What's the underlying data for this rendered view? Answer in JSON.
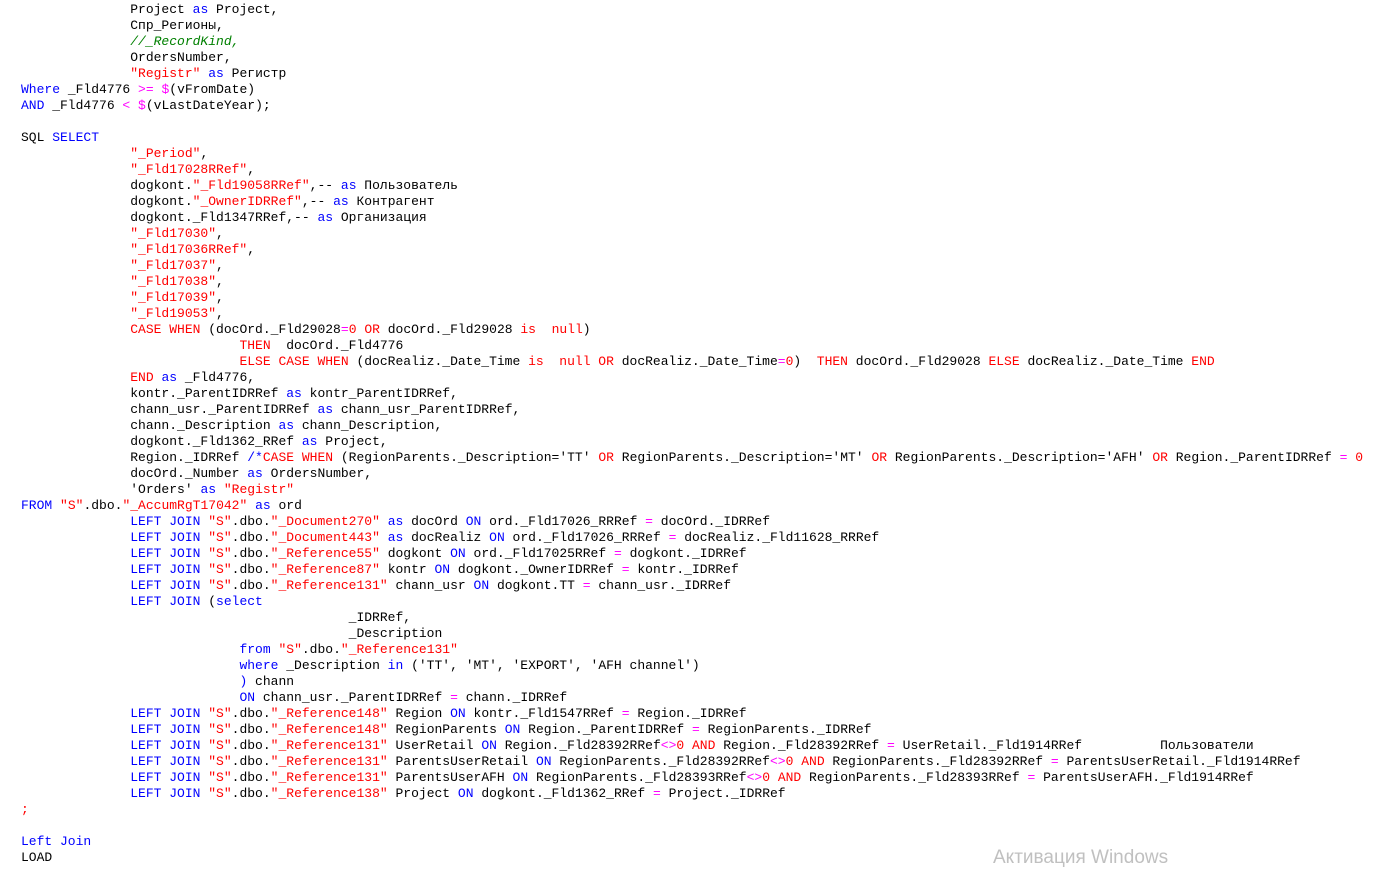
{
  "colors": {
    "keyword": "#0000ff",
    "string": "#ff0000",
    "comment": "#008000",
    "operator": "#ff00ff",
    "text": "#000000",
    "watermark": "#c0c0c0"
  },
  "watermark": "Активация Windows",
  "code_lines": [
    [
      [
        "t",
        "              Project "
      ],
      [
        "k",
        "as"
      ],
      [
        "t",
        " Project,"
      ]
    ],
    [
      [
        "t",
        "              Спр_Регионы,"
      ]
    ],
    [
      [
        "c",
        "              //_RecordKind,"
      ]
    ],
    [
      [
        "t",
        "              OrdersNumber,"
      ]
    ],
    [
      [
        "t",
        "              "
      ],
      [
        "s",
        "\"Registr\""
      ],
      [
        "t",
        " "
      ],
      [
        "k",
        "as"
      ],
      [
        "t",
        " Регистр"
      ]
    ],
    [
      [
        "k",
        "Where"
      ],
      [
        "t",
        " _Fld4776 "
      ],
      [
        "o",
        ">="
      ],
      [
        "t",
        " "
      ],
      [
        "o",
        "$"
      ],
      [
        "t",
        "(vFromDate)"
      ]
    ],
    [
      [
        "k",
        "AND"
      ],
      [
        "t",
        " _Fld4776 "
      ],
      [
        "o",
        "<"
      ],
      [
        "t",
        " "
      ],
      [
        "o",
        "$"
      ],
      [
        "t",
        "(vLastDateYear);"
      ]
    ],
    [
      [
        "t",
        ""
      ]
    ],
    [
      [
        "t",
        "SQL "
      ],
      [
        "k",
        "SELECT"
      ]
    ],
    [
      [
        "t",
        "              "
      ],
      [
        "s",
        "\"_Period\""
      ],
      [
        "t",
        ","
      ]
    ],
    [
      [
        "t",
        "              "
      ],
      [
        "s",
        "\"_Fld17028RRef\""
      ],
      [
        "t",
        ","
      ]
    ],
    [
      [
        "t",
        "              dogkont."
      ],
      [
        "s",
        "\"_Fld19058RRef\""
      ],
      [
        "t",
        ",-- "
      ],
      [
        "k",
        "as"
      ],
      [
        "t",
        " Пользователь"
      ]
    ],
    [
      [
        "t",
        "              dogkont."
      ],
      [
        "s",
        "\"_OwnerIDRRef\""
      ],
      [
        "t",
        ",-- "
      ],
      [
        "k",
        "as"
      ],
      [
        "t",
        " Контрагент"
      ]
    ],
    [
      [
        "t",
        "              dogkont._Fld1347RRef,-- "
      ],
      [
        "k",
        "as"
      ],
      [
        "t",
        " Организация"
      ]
    ],
    [
      [
        "t",
        "              "
      ],
      [
        "s",
        "\"_Fld17030\""
      ],
      [
        "t",
        ","
      ]
    ],
    [
      [
        "t",
        "              "
      ],
      [
        "s",
        "\"_Fld17036RRef\""
      ],
      [
        "t",
        ","
      ]
    ],
    [
      [
        "t",
        "              "
      ],
      [
        "s",
        "\"_Fld17037\""
      ],
      [
        "t",
        ","
      ]
    ],
    [
      [
        "t",
        "              "
      ],
      [
        "s",
        "\"_Fld17038\""
      ],
      [
        "t",
        ","
      ]
    ],
    [
      [
        "t",
        "              "
      ],
      [
        "s",
        "\"_Fld17039\""
      ],
      [
        "t",
        ","
      ]
    ],
    [
      [
        "t",
        "              "
      ],
      [
        "s",
        "\"_Fld19053\""
      ],
      [
        "t",
        ","
      ]
    ],
    [
      [
        "t",
        "              "
      ],
      [
        "s",
        "CASE WHEN"
      ],
      [
        "t",
        " (docOrd._Fld29028"
      ],
      [
        "o",
        "="
      ],
      [
        "s",
        "0"
      ],
      [
        "t",
        " "
      ],
      [
        "s",
        "OR"
      ],
      [
        "t",
        " docOrd._Fld29028 "
      ],
      [
        "s",
        "is  null"
      ],
      [
        "t",
        ")"
      ]
    ],
    [
      [
        "t",
        "                            "
      ],
      [
        "s",
        "THEN"
      ],
      [
        "t",
        "  docOrd._Fld4776"
      ]
    ],
    [
      [
        "t",
        "                            "
      ],
      [
        "s",
        "ELSE CASE WHEN"
      ],
      [
        "t",
        " (docRealiz._Date_Time "
      ],
      [
        "s",
        "is  null OR"
      ],
      [
        "t",
        " docRealiz._Date_Time"
      ],
      [
        "o",
        "="
      ],
      [
        "s",
        "0"
      ],
      [
        "t",
        ")  "
      ],
      [
        "s",
        "THEN"
      ],
      [
        "t",
        " docOrd._Fld29028 "
      ],
      [
        "s",
        "ELSE"
      ],
      [
        "t",
        " docRealiz._Date_Time "
      ],
      [
        "s",
        "END"
      ]
    ],
    [
      [
        "t",
        "              "
      ],
      [
        "s",
        "END"
      ],
      [
        "t",
        " "
      ],
      [
        "k",
        "as"
      ],
      [
        "t",
        " _Fld4776,"
      ]
    ],
    [
      [
        "t",
        "              kontr._ParentIDRRef "
      ],
      [
        "k",
        "as"
      ],
      [
        "t",
        " kontr_ParentIDRRef,"
      ]
    ],
    [
      [
        "t",
        "              chann_usr._ParentIDRRef "
      ],
      [
        "k",
        "as"
      ],
      [
        "t",
        " chann_usr_ParentIDRRef,"
      ]
    ],
    [
      [
        "t",
        "              chann._Description "
      ],
      [
        "k",
        "as"
      ],
      [
        "t",
        " chann_Description,"
      ]
    ],
    [
      [
        "t",
        "              dogkont._Fld1362_RRef "
      ],
      [
        "k",
        "as"
      ],
      [
        "t",
        " Project,"
      ]
    ],
    [
      [
        "t",
        "              Region._IDRRef "
      ],
      [
        "k",
        "/*"
      ],
      [
        "s",
        "CASE WHEN"
      ],
      [
        "t",
        " (RegionParents._Description="
      ],
      [
        "t",
        "'TT'"
      ],
      [
        "t",
        " "
      ],
      [
        "s",
        "OR"
      ],
      [
        "t",
        " RegionParents._Description="
      ],
      [
        "t",
        "'MT'"
      ],
      [
        "t",
        " "
      ],
      [
        "s",
        "OR"
      ],
      [
        "t",
        " RegionParents._Description="
      ],
      [
        "t",
        "'AFH'"
      ],
      [
        "t",
        " "
      ],
      [
        "s",
        "OR"
      ],
      [
        "t",
        " Region._ParentIDRRef "
      ],
      [
        "o",
        "="
      ],
      [
        "t",
        " "
      ],
      [
        "s",
        "0"
      ]
    ],
    [
      [
        "t",
        "              docOrd._Number "
      ],
      [
        "k",
        "as"
      ],
      [
        "t",
        " OrdersNumber,"
      ]
    ],
    [
      [
        "t",
        "              'Orders' "
      ],
      [
        "k",
        "as"
      ],
      [
        "t",
        " "
      ],
      [
        "s",
        "\"Registr\""
      ]
    ],
    [
      [
        "k",
        "FROM"
      ],
      [
        "t",
        " "
      ],
      [
        "s",
        "\"S\""
      ],
      [
        "t",
        ".dbo."
      ],
      [
        "s",
        "\"_AccumRgT17042\""
      ],
      [
        "t",
        " "
      ],
      [
        "k",
        "as"
      ],
      [
        "t",
        " ord"
      ]
    ],
    [
      [
        "t",
        "              "
      ],
      [
        "k",
        "LEFT JOIN"
      ],
      [
        "t",
        " "
      ],
      [
        "s",
        "\"S\""
      ],
      [
        "t",
        ".dbo."
      ],
      [
        "s",
        "\"_Document270\""
      ],
      [
        "t",
        " "
      ],
      [
        "k",
        "as"
      ],
      [
        "t",
        " docOrd "
      ],
      [
        "k",
        "ON"
      ],
      [
        "t",
        " ord._Fld17026_RRRef "
      ],
      [
        "o",
        "="
      ],
      [
        "t",
        " docOrd._IDRRef"
      ]
    ],
    [
      [
        "t",
        "              "
      ],
      [
        "k",
        "LEFT JOIN"
      ],
      [
        "t",
        " "
      ],
      [
        "s",
        "\"S\""
      ],
      [
        "t",
        ".dbo."
      ],
      [
        "s",
        "\"_Document443\""
      ],
      [
        "t",
        " "
      ],
      [
        "k",
        "as"
      ],
      [
        "t",
        " docRealiz "
      ],
      [
        "k",
        "ON"
      ],
      [
        "t",
        " ord._Fld17026_RRRef "
      ],
      [
        "o",
        "="
      ],
      [
        "t",
        " docRealiz._Fld11628_RRRef"
      ]
    ],
    [
      [
        "t",
        "              "
      ],
      [
        "k",
        "LEFT JOIN"
      ],
      [
        "t",
        " "
      ],
      [
        "s",
        "\"S\""
      ],
      [
        "t",
        ".dbo."
      ],
      [
        "s",
        "\"_Reference55\""
      ],
      [
        "t",
        " dogkont "
      ],
      [
        "k",
        "ON"
      ],
      [
        "t",
        " ord._Fld17025RRef "
      ],
      [
        "o",
        "="
      ],
      [
        "t",
        " dogkont._IDRRef"
      ]
    ],
    [
      [
        "t",
        "              "
      ],
      [
        "k",
        "LEFT JOIN"
      ],
      [
        "t",
        " "
      ],
      [
        "s",
        "\"S\""
      ],
      [
        "t",
        ".dbo."
      ],
      [
        "s",
        "\"_Reference87\""
      ],
      [
        "t",
        " kontr "
      ],
      [
        "k",
        "ON"
      ],
      [
        "t",
        " dogkont._OwnerIDRRef "
      ],
      [
        "o",
        "="
      ],
      [
        "t",
        " kontr._IDRRef"
      ]
    ],
    [
      [
        "t",
        "              "
      ],
      [
        "k",
        "LEFT JOIN"
      ],
      [
        "t",
        " "
      ],
      [
        "s",
        "\"S\""
      ],
      [
        "t",
        ".dbo."
      ],
      [
        "s",
        "\"_Reference131\""
      ],
      [
        "t",
        " chann_usr "
      ],
      [
        "k",
        "ON"
      ],
      [
        "t",
        " dogkont.TT "
      ],
      [
        "o",
        "="
      ],
      [
        "t",
        " chann_usr._IDRRef"
      ]
    ],
    [
      [
        "t",
        "              "
      ],
      [
        "k",
        "LEFT JOIN"
      ],
      [
        "t",
        " ("
      ],
      [
        "k",
        "select"
      ]
    ],
    [
      [
        "t",
        "                                          _IDRRef,"
      ]
    ],
    [
      [
        "t",
        "                                          _Description"
      ]
    ],
    [
      [
        "t",
        "                            "
      ],
      [
        "k",
        "from"
      ],
      [
        "t",
        " "
      ],
      [
        "s",
        "\"S\""
      ],
      [
        "t",
        ".dbo."
      ],
      [
        "s",
        "\"_Reference131\""
      ]
    ],
    [
      [
        "t",
        "                            "
      ],
      [
        "k",
        "where"
      ],
      [
        "t",
        " _Description "
      ],
      [
        "k",
        "in"
      ],
      [
        "t",
        " ('TT', 'MT', 'EXPORT', 'AFH channel')"
      ]
    ],
    [
      [
        "t",
        "                            "
      ],
      [
        "k",
        ")"
      ],
      [
        "t",
        " chann"
      ]
    ],
    [
      [
        "t",
        "                            "
      ],
      [
        "k",
        "ON"
      ],
      [
        "t",
        " chann_usr._ParentIDRRef "
      ],
      [
        "o",
        "="
      ],
      [
        "t",
        " chann._IDRRef"
      ]
    ],
    [
      [
        "t",
        "              "
      ],
      [
        "k",
        "LEFT JOIN"
      ],
      [
        "t",
        " "
      ],
      [
        "s",
        "\"S\""
      ],
      [
        "t",
        ".dbo."
      ],
      [
        "s",
        "\"_Reference148\""
      ],
      [
        "t",
        " Region "
      ],
      [
        "k",
        "ON"
      ],
      [
        "t",
        " kontr._Fld1547RRef "
      ],
      [
        "o",
        "="
      ],
      [
        "t",
        " Region._IDRRef"
      ]
    ],
    [
      [
        "t",
        "              "
      ],
      [
        "k",
        "LEFT JOIN"
      ],
      [
        "t",
        " "
      ],
      [
        "s",
        "\"S\""
      ],
      [
        "t",
        ".dbo."
      ],
      [
        "s",
        "\"_Reference148\""
      ],
      [
        "t",
        " RegionParents "
      ],
      [
        "k",
        "ON"
      ],
      [
        "t",
        " Region._ParentIDRRef "
      ],
      [
        "o",
        "="
      ],
      [
        "t",
        " RegionParents._IDRRef"
      ]
    ],
    [
      [
        "t",
        "              "
      ],
      [
        "k",
        "LEFT JOIN"
      ],
      [
        "t",
        " "
      ],
      [
        "s",
        "\"S\""
      ],
      [
        "t",
        ".dbo."
      ],
      [
        "s",
        "\"_Reference131\""
      ],
      [
        "t",
        " UserRetail "
      ],
      [
        "k",
        "ON"
      ],
      [
        "t",
        " Region._Fld28392RRef"
      ],
      [
        "o",
        "<>"
      ],
      [
        "s",
        "0"
      ],
      [
        "t",
        " "
      ],
      [
        "s",
        "AND"
      ],
      [
        "t",
        " Region._Fld28392RRef "
      ],
      [
        "o",
        "="
      ],
      [
        "t",
        " UserRetail._Fld1914RRef          Пользователи"
      ]
    ],
    [
      [
        "t",
        "              "
      ],
      [
        "k",
        "LEFT JOIN"
      ],
      [
        "t",
        " "
      ],
      [
        "s",
        "\"S\""
      ],
      [
        "t",
        ".dbo."
      ],
      [
        "s",
        "\"_Reference131\""
      ],
      [
        "t",
        " ParentsUserRetail "
      ],
      [
        "k",
        "ON"
      ],
      [
        "t",
        " RegionParents._Fld28392RRef"
      ],
      [
        "o",
        "<>"
      ],
      [
        "s",
        "0"
      ],
      [
        "t",
        " "
      ],
      [
        "s",
        "AND"
      ],
      [
        "t",
        " RegionParents._Fld28392RRef "
      ],
      [
        "o",
        "="
      ],
      [
        "t",
        " ParentsUserRetail._Fld1914RRef"
      ]
    ],
    [
      [
        "t",
        "              "
      ],
      [
        "k",
        "LEFT JOIN"
      ],
      [
        "t",
        " "
      ],
      [
        "s",
        "\"S\""
      ],
      [
        "t",
        ".dbo."
      ],
      [
        "s",
        "\"_Reference131\""
      ],
      [
        "t",
        " ParentsUserAFH "
      ],
      [
        "k",
        "ON"
      ],
      [
        "t",
        " RegionParents._Fld28393RRef"
      ],
      [
        "o",
        "<>"
      ],
      [
        "s",
        "0"
      ],
      [
        "t",
        " "
      ],
      [
        "s",
        "AND"
      ],
      [
        "t",
        " RegionParents._Fld28393RRef "
      ],
      [
        "o",
        "="
      ],
      [
        "t",
        " ParentsUserAFH._Fld1914RRef"
      ]
    ],
    [
      [
        "t",
        "              "
      ],
      [
        "k",
        "LEFT JOIN"
      ],
      [
        "t",
        " "
      ],
      [
        "s",
        "\"S\""
      ],
      [
        "t",
        ".dbo."
      ],
      [
        "s",
        "\"_Reference138\""
      ],
      [
        "t",
        " Project "
      ],
      [
        "k",
        "ON"
      ],
      [
        "t",
        " dogkont._Fld1362_RRef "
      ],
      [
        "o",
        "="
      ],
      [
        "t",
        " Project._IDRRef"
      ]
    ],
    [
      [
        "s",
        ";"
      ]
    ],
    [
      [
        "t",
        ""
      ]
    ],
    [
      [
        "k",
        "Left Join"
      ]
    ],
    [
      [
        "t",
        "LOAD"
      ]
    ]
  ]
}
